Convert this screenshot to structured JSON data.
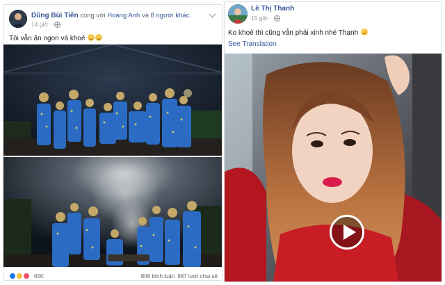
{
  "left_post": {
    "author": "Dũng Bùi Tiến",
    "with_text": "cùng với",
    "tagged": "Hoàng Anh",
    "and_text": "và",
    "others": "8 người khác.",
    "time": "14 giờ",
    "text": "Tôi vẫn ăn ngon và khoẻ",
    "text_emoji": "grinning-face-icon",
    "reactions_count": "65K",
    "comments": "806 bình luận",
    "shares": "987 lượt chia sẻ"
  },
  "right_post": {
    "author": "Lê Thị Thanh",
    "time": "15 giờ",
    "text": "Ko khoẻ thì cũng vẫn phải xinh nhé Thanh",
    "text_emoji": "smiling-face-icon",
    "see_translation": "See Translation",
    "play_icon": "play-icon"
  },
  "colors": {
    "link": "#385898",
    "meta": "#90949c",
    "text": "#1d2129",
    "like": "#2078f4",
    "haha": "#f5c33b",
    "love": "#f0516b"
  }
}
